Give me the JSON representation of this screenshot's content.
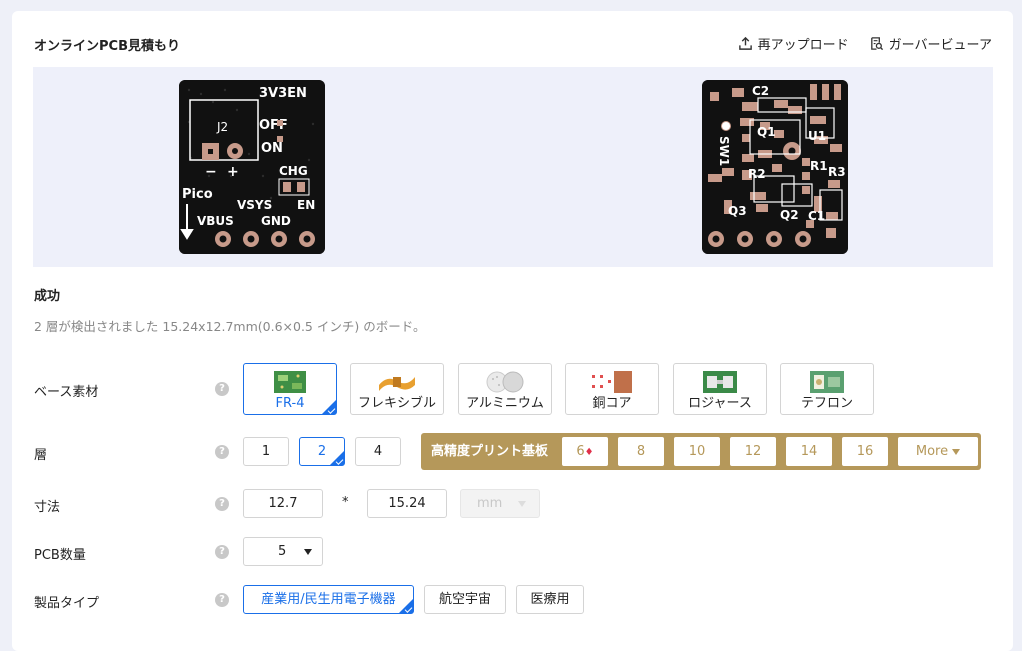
{
  "header": {
    "title": "オンラインPCB見積もり",
    "reupload_label": "再アップロード",
    "gerber_viewer_label": "ガーバービューア"
  },
  "preview": {
    "front_labels": [
      "3V3EN",
      "J2",
      "OFF",
      "ON",
      "−",
      "+",
      "CHG",
      "Pico",
      "VSYS",
      "EN",
      "VBUS",
      "GND"
    ],
    "back_labels": [
      "C2",
      "Q1",
      "U1",
      "SW1",
      "R1",
      "R2",
      "R3",
      "Q3",
      "Q2",
      "C1"
    ]
  },
  "status": {
    "title": "成功",
    "description": "2 層が検出されました 15.24x12.7mm(0.6×0.5 インチ) のボード。"
  },
  "base_material": {
    "label": "ベース素材",
    "options": [
      "FR-4",
      "フレキシブル",
      "アルミニウム",
      "銅コア",
      "ロジャース",
      "テフロン"
    ],
    "selected": "FR-4"
  },
  "layers": {
    "label": "層",
    "options": [
      "1",
      "2",
      "4"
    ],
    "selected": "2",
    "hd_title": "高精度プリント基板",
    "hd_options": [
      "6",
      "8",
      "10",
      "12",
      "14",
      "16"
    ],
    "more_label": "More"
  },
  "dimensions": {
    "label": "寸法",
    "width": "12.7",
    "separator": "*",
    "height": "15.24",
    "unit": "mm"
  },
  "quantity": {
    "label": "PCB数量",
    "value": "5"
  },
  "product_type": {
    "label": "製品タイプ",
    "options": [
      "産業用/民生用電子機器",
      "航空宇宙",
      "医療用"
    ],
    "selected": "産業用/民生用電子機器"
  },
  "help_icon_glyph": "?",
  "colors": {
    "accent": "#1a6fe8",
    "gold": "#b5985a",
    "board": "#111111",
    "pad": "#c79a8a"
  }
}
